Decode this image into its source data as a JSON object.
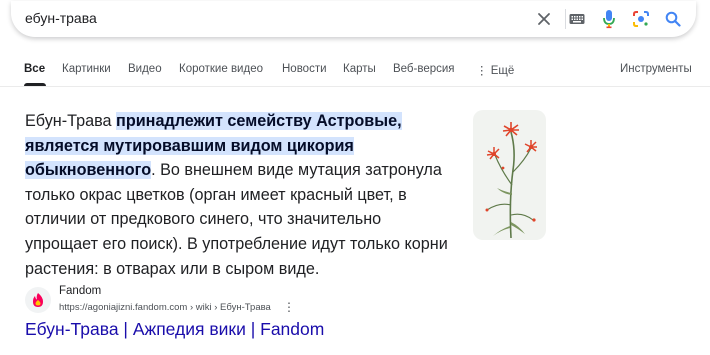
{
  "search": {
    "query": "ебун-трава",
    "icons": [
      "close-icon",
      "keyboard-icon",
      "mic-icon",
      "lens-icon",
      "search-icon"
    ]
  },
  "tabs": [
    {
      "label": "Все",
      "active": true
    },
    {
      "label": "Картинки"
    },
    {
      "label": "Видео"
    },
    {
      "label": "Короткие видео"
    },
    {
      "label": "Новости"
    },
    {
      "label": "Карты"
    },
    {
      "label": "Веб-версия"
    },
    {
      "label": "Ещё"
    }
  ],
  "tools_label": "Инструменты",
  "snippet": {
    "part1": "Ебун-Трава ",
    "highlight": "принадлежит семейству Астровые, является мутировавшим видом цикория обыкновенного",
    "part2": ". Во внешнем виде мутация затронула только окрас цветков (орган имеет красный цвет, в отличии от предкового синего, что значительно упрощает его поиск). В употребление идут только корни растения: в отварах или в сыром виде."
  },
  "source": {
    "name": "Fandom",
    "url": "https://agoniajizni.fandom.com",
    "breadcrumb": " › wiki › Ебун-Трава",
    "more": "⋮"
  },
  "result_title": "Ебун-Трава | Ажпедия вики | Fandom",
  "colors": {
    "highlight_bg": "#d3e3fd",
    "link": "#1a0dab",
    "flower": "#e0452b",
    "stem": "#5f7a4a"
  }
}
